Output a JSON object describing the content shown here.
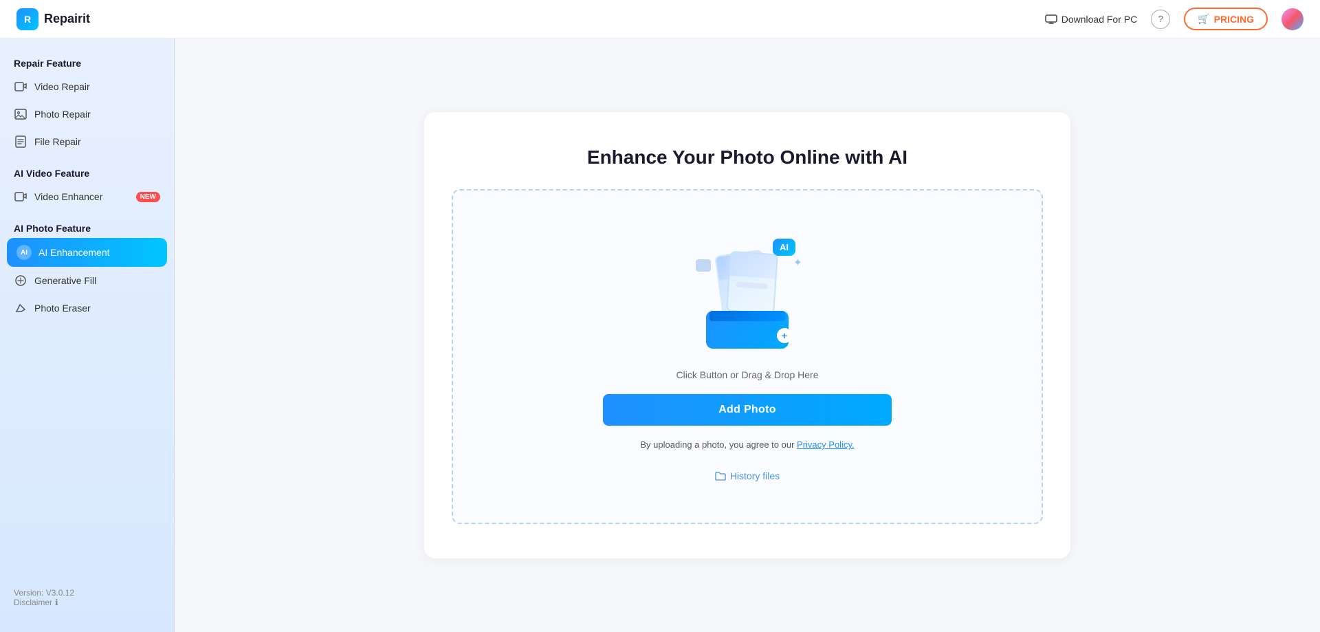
{
  "header": {
    "logo_text": "Repairit",
    "download_label": "Download For PC",
    "pricing_label": "PRICING",
    "pricing_icon": "🛒"
  },
  "sidebar": {
    "repair_section_label": "Repair Feature",
    "repair_items": [
      {
        "id": "video-repair",
        "label": "Video Repair",
        "icon": "▶"
      },
      {
        "id": "photo-repair",
        "label": "Photo Repair",
        "icon": "🖼"
      },
      {
        "id": "file-repair",
        "label": "File Repair",
        "icon": "📄"
      }
    ],
    "ai_video_section_label": "AI Video Feature",
    "ai_video_items": [
      {
        "id": "video-enhancer",
        "label": "Video Enhancer",
        "icon": "✨",
        "badge": "NEW"
      }
    ],
    "ai_photo_section_label": "AI Photo Feature",
    "ai_photo_items": [
      {
        "id": "ai-enhancement",
        "label": "AI Enhancement",
        "icon": "AI",
        "active": true
      },
      {
        "id": "generative-fill",
        "label": "Generative Fill",
        "icon": "◇"
      },
      {
        "id": "photo-eraser",
        "label": "Photo Eraser",
        "icon": "◇"
      }
    ],
    "version": "Version: V3.0.12",
    "disclaimer": "Disclaimer"
  },
  "main": {
    "page_title": "Enhance Your Photo Online with AI",
    "drag_text": "Click Button or Drag & Drop Here",
    "add_photo_label": "Add Photo",
    "privacy_prefix": "By uploading a photo, you agree to our ",
    "privacy_link_text": "Privacy Policy.",
    "history_label": "History files"
  }
}
